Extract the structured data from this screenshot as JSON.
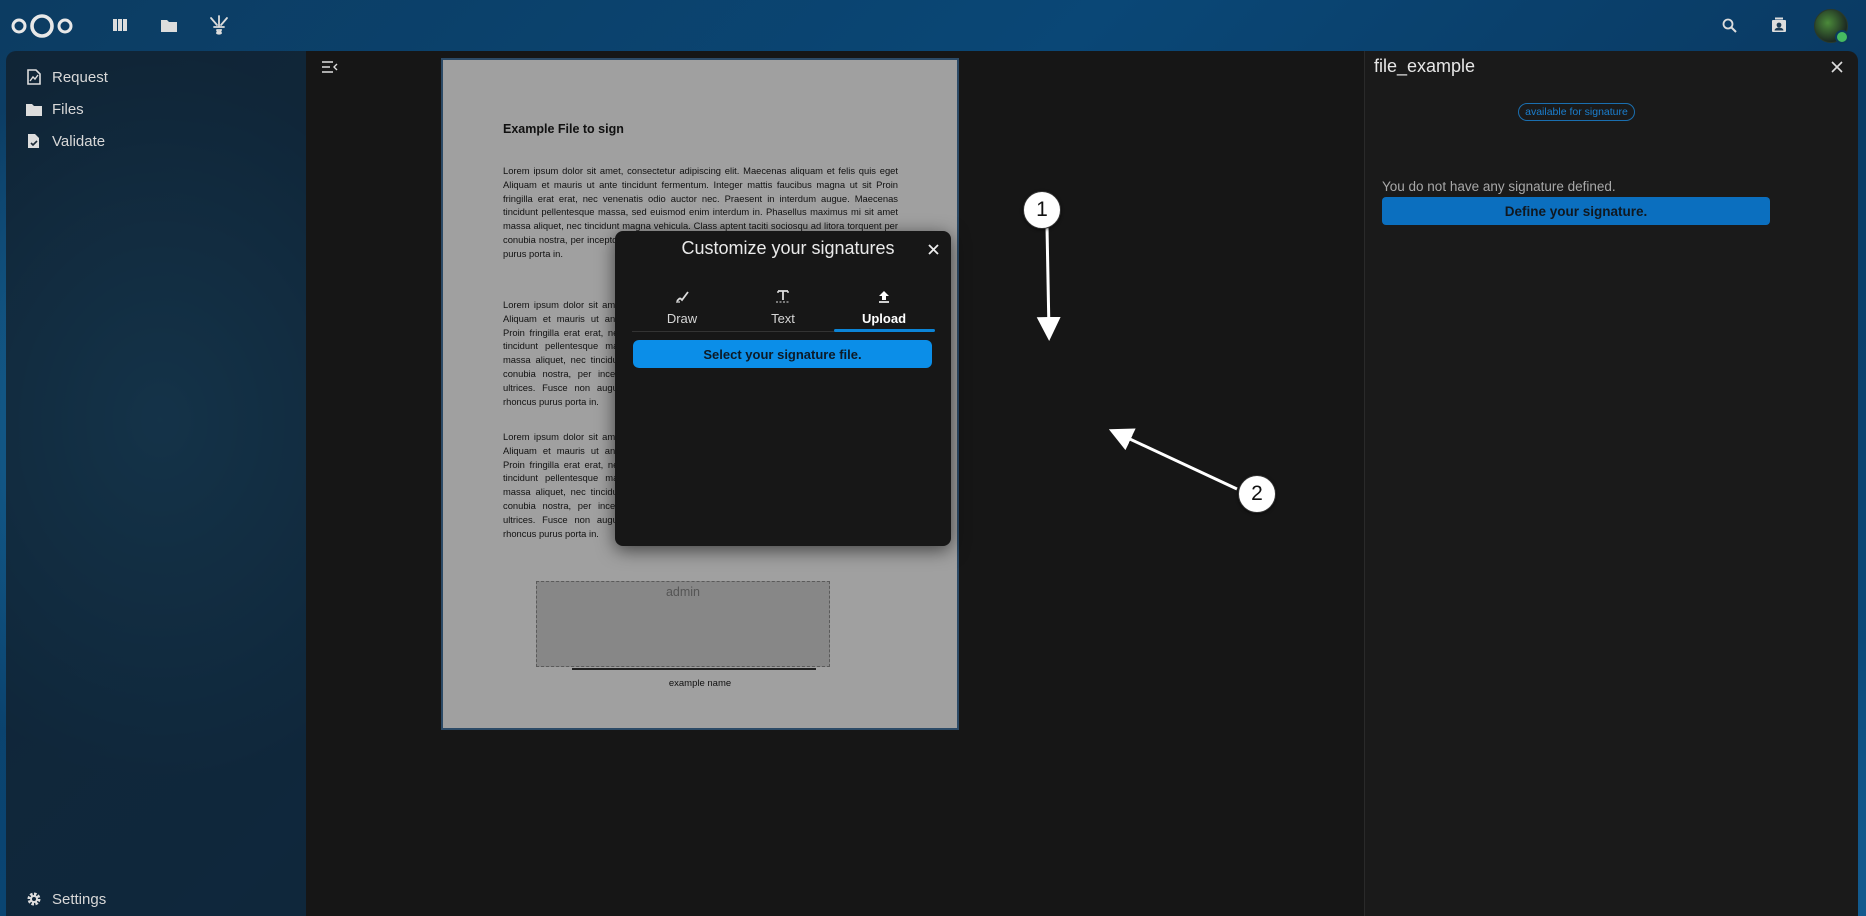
{
  "nav": {
    "items": [
      {
        "label": "Request",
        "icon": "signature-request-icon"
      },
      {
        "label": "Files",
        "icon": "folder-icon"
      },
      {
        "label": "Validate",
        "icon": "file-check-icon"
      }
    ],
    "settings_label": "Settings"
  },
  "document": {
    "title": "Example File to sign",
    "paragraphs": [
      "Lorem ipsum dolor sit amet, consectetur adipiscing elit. Maecenas aliquam et felis quis eget Aliquam et mauris ut ante tincidunt fermentum. Integer mattis faucibus magna ut sit Proin fringilla erat erat, nec venenatis odio auctor nec. Praesent in interdum augue. Maecenas tincidunt pellentesque massa, sed euismod enim interdum in. Phasellus maximus mi sit amet massa aliquet, nec tincidunt magna vehicula. Class aptent taciti sociosqu ad litora torquent per conubia nostra, per inceptos himenaeos. Fusce non augue ultrices. Fusce non augue rhoncus purus porta in.",
      "Lorem ipsum dolor sit amet Aliquam et mauris ut ante Proin fringilla erat erat, nec tincidunt pellentesque mas massa aliquet, nec tincidun conubia nostra, per incept ultrices. Fusce non augue rhoncus purus porta in.",
      "Lorem ipsum dolor sit amet Aliquam et mauris ut ante Proin fringilla erat erat, nec tincidunt pellentesque mas massa aliquet, nec tincidun conubia nostra, per incept ultrices. Fusce non augue rhoncus purus porta in."
    ],
    "signature_box_label": "admin",
    "signer_name": "example name"
  },
  "modal": {
    "title": "Customize your signatures",
    "tabs": [
      {
        "label": "Draw",
        "icon": "draw-icon"
      },
      {
        "label": "Text",
        "icon": "text-icon"
      },
      {
        "label": "Upload",
        "icon": "upload-icon",
        "active": true
      }
    ],
    "select_button": "Select your signature file."
  },
  "sidebar": {
    "title": "file_example",
    "badge": "available for signature",
    "info": "You do not have any signature defined.",
    "define_button": "Define your signature."
  },
  "callouts": [
    "1",
    "2"
  ],
  "colors": {
    "accent": "#0b8ee8",
    "sidebar_button": "#0b6fbf",
    "background": "#0b3a5c"
  }
}
